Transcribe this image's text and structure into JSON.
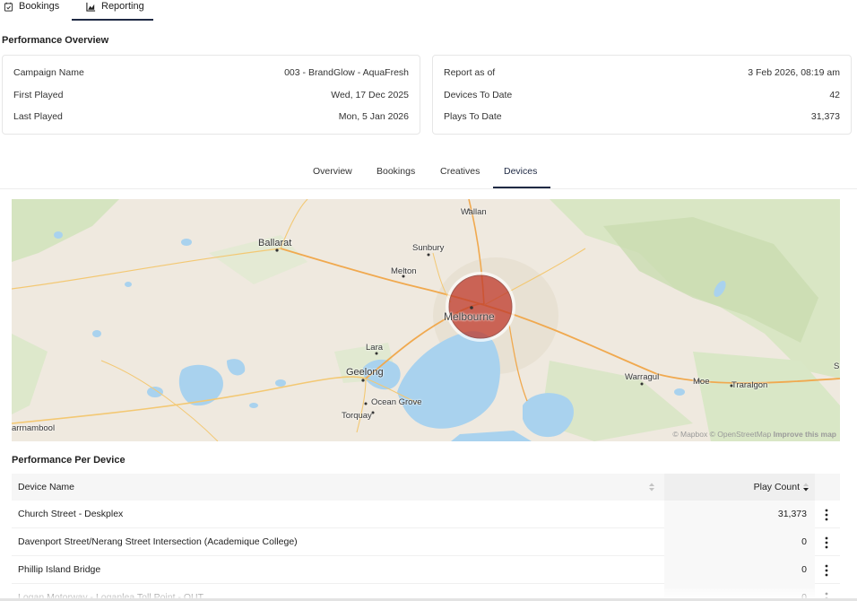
{
  "top_tabs": [
    {
      "label": "Bookings",
      "icon": "calendar-check-icon"
    },
    {
      "label": "Reporting",
      "icon": "chart-area-icon",
      "active": true
    }
  ],
  "overview": {
    "title": "Performance Overview",
    "left": [
      {
        "key": "Campaign Name",
        "value": "003 - BrandGlow - AquaFresh"
      },
      {
        "key": "First Played",
        "value": "Wed, 17 Dec 2025"
      },
      {
        "key": "Last Played",
        "value": "Mon, 5 Jan 2026"
      }
    ],
    "right": [
      {
        "key": "Report as of",
        "value": "3 Feb 2026, 08:19 am"
      },
      {
        "key": "Devices To Date",
        "value": "42"
      },
      {
        "key": "Plays To Date",
        "value": "31,373"
      }
    ]
  },
  "sub_tabs": [
    {
      "label": "Overview"
    },
    {
      "label": "Bookings"
    },
    {
      "label": "Creatives"
    },
    {
      "label": "Devices",
      "active": true
    }
  ],
  "map": {
    "labels": {
      "wallan": "Wallan",
      "ballarat": "Ballarat",
      "sunbury": "Sunbury",
      "melton": "Melton",
      "melbourne": "Melbourne",
      "lara": "Lara",
      "geelong": "Geelong",
      "ocean_grove": "Ocean Grove",
      "torquay": "Torquay",
      "warrnambool": "arrnambool",
      "warragul": "Warragul",
      "moe": "Moe",
      "traralgon": "Traralgon",
      "edge_s": "S"
    },
    "attribution": "© Mapbox © OpenStreetMap",
    "improve": "Improve this map",
    "marker_color": "#c0392b"
  },
  "devices": {
    "title": "Performance Per Device",
    "columns": {
      "name": "Device Name",
      "count": "Play Count"
    },
    "rows": [
      {
        "name": "Church Street - Deskplex",
        "count": "31,373"
      },
      {
        "name": "Davenport Street/Nerang Street Intersection (Academique College)",
        "count": "0"
      },
      {
        "name": "Phillip Island Bridge",
        "count": "0"
      },
      {
        "name": "Logan Motorway - Loganlea Toll Point - OUT",
        "count": "0"
      }
    ]
  },
  "colors": {
    "accent": "#1f2a44",
    "water": "#a9d2ee",
    "land": "#efe9df",
    "park": "#cfe3b6"
  }
}
